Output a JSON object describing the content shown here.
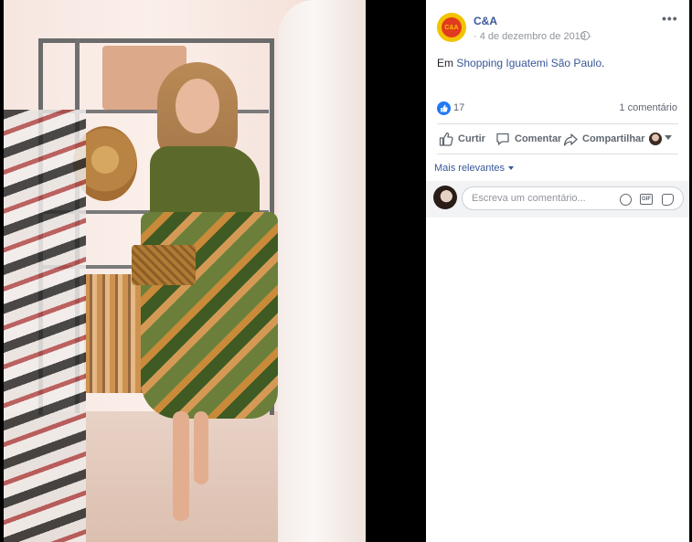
{
  "post": {
    "page_name": "C&A",
    "logo_text": "C&A",
    "date": "· 4 de dezembro de 2019 ·",
    "location_prefix": "Em ",
    "location_link": "Shopping Iguatemi São Paulo",
    "location_suffix": "."
  },
  "stats": {
    "likes": "17",
    "comments": "1 comentário"
  },
  "actions": {
    "like": "Curtir",
    "comment": "Comentar",
    "share": "Compartilhar"
  },
  "comments": {
    "sort_label": "Mais relevantes",
    "input_placeholder": "Escreva um comentário..."
  },
  "icons": {
    "more": "more-icon",
    "globe": "globe-icon",
    "like": "like-icon",
    "comment": "comment-icon",
    "share": "share-icon",
    "emoji": "emoji-icon",
    "gif": "gif-icon",
    "sticker": "sticker-icon"
  },
  "colors": {
    "link": "#385898",
    "like_badge": "#2078f4",
    "logo_bg": "#f2c300",
    "logo_fg": "#e23a1f"
  }
}
